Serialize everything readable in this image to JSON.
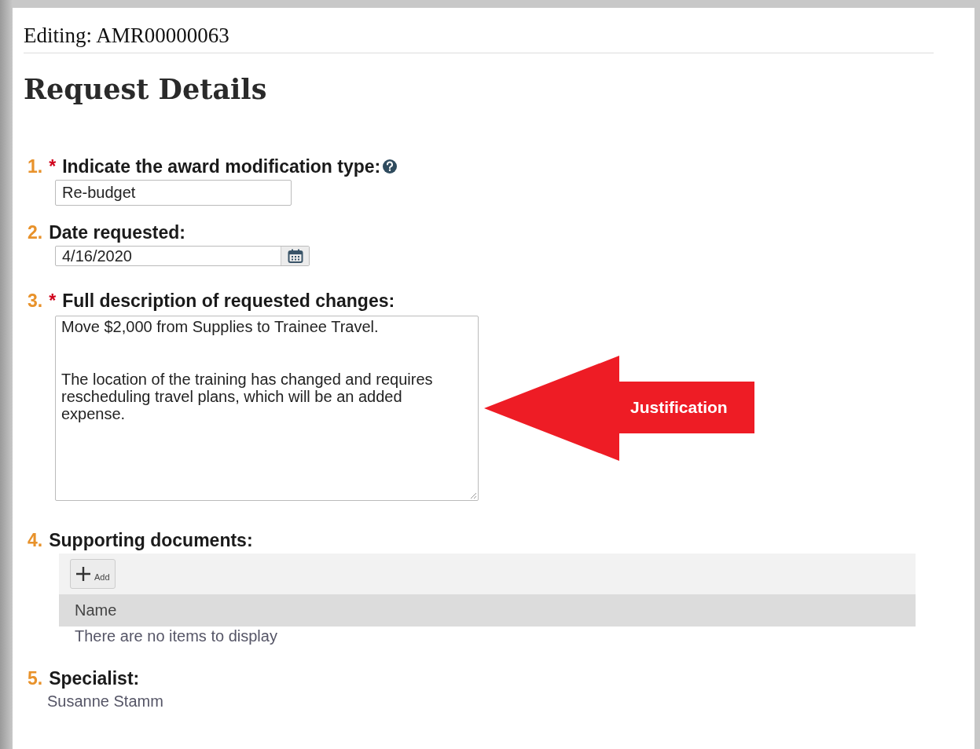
{
  "header": {
    "title": "Editing: AMR00000063"
  },
  "section_title": "Request Details",
  "questions": [
    {
      "number": "1.",
      "required_mark": "*",
      "label": "Indicate the award modification type:",
      "help": true,
      "kind": "text",
      "value": "Re-budget"
    },
    {
      "number": "2.",
      "label": "Date requested:",
      "kind": "date",
      "value": "4/16/2020"
    },
    {
      "number": "3.",
      "required_mark": "*",
      "label": "Full description of requested changes:",
      "kind": "textarea",
      "paragraphs": [
        "Move $2,000 from Supplies to Trainee Travel.",
        "The location of the training has changed and requires rescheduling travel plans, which will be an added expense."
      ]
    },
    {
      "number": "4.",
      "label": "Supporting documents:",
      "kind": "documents",
      "add_button": "Add",
      "columns": [
        "Name"
      ],
      "empty_message": "There are no items to display"
    },
    {
      "number": "5.",
      "label": "Specialist:",
      "kind": "readonly",
      "value": "Susanne Stamm"
    }
  ],
  "callout": {
    "label": "Justification"
  }
}
